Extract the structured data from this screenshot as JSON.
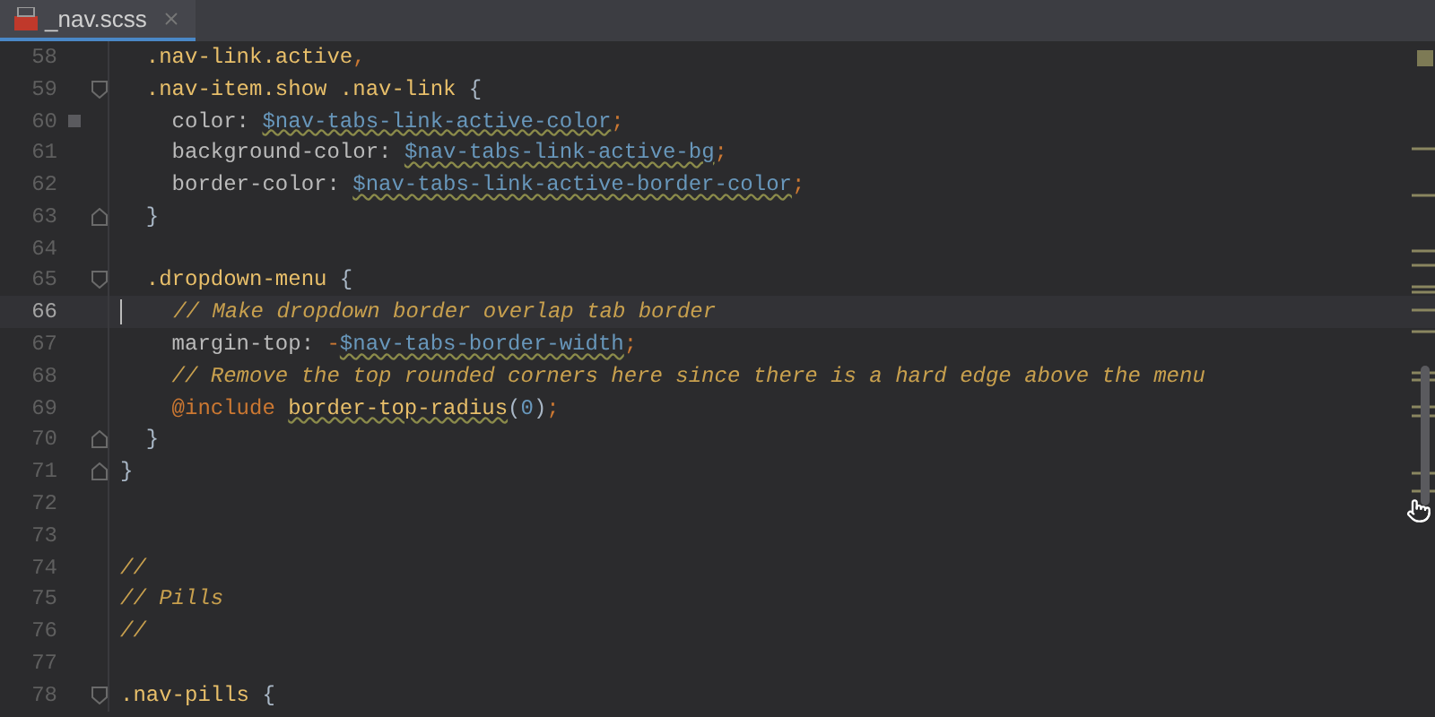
{
  "tabs": [
    {
      "label": "_nav.scss",
      "selected": true
    }
  ],
  "lines": [
    {
      "number": "58",
      "current": false,
      "fold_start": false,
      "fold_end": false,
      "segments": [
        {
          "kind": "selector",
          "text": "  .nav-link.active"
        },
        {
          "kind": "punct",
          "text": ","
        }
      ]
    },
    {
      "number": "59",
      "current": false,
      "fold_start": true,
      "fold_end": false,
      "segments": [
        {
          "kind": "selector",
          "text": "  .nav-item.show .nav-link"
        },
        {
          "kind": "plain",
          "text": " {"
        }
      ]
    },
    {
      "number": "60",
      "current": false,
      "fold_start": false,
      "fold_end": false,
      "bookmark": true,
      "segments": [
        {
          "kind": "property",
          "text": "    color: "
        },
        {
          "kind": "variable",
          "text": "$nav-tabs-link-active-color"
        },
        {
          "kind": "punct",
          "text": ";"
        }
      ]
    },
    {
      "number": "61",
      "current": false,
      "fold_start": false,
      "fold_end": false,
      "segments": [
        {
          "kind": "property",
          "text": "    background-color: "
        },
        {
          "kind": "variable",
          "text": "$nav-tabs-link-active-bg"
        },
        {
          "kind": "punct",
          "text": ";"
        }
      ]
    },
    {
      "number": "62",
      "current": false,
      "fold_start": false,
      "fold_end": false,
      "segments": [
        {
          "kind": "property",
          "text": "    border-color: "
        },
        {
          "kind": "variable",
          "text": "$nav-tabs-link-active-border-color"
        },
        {
          "kind": "punct",
          "text": ";"
        }
      ]
    },
    {
      "number": "63",
      "current": false,
      "fold_start": false,
      "fold_end": true,
      "segments": [
        {
          "kind": "plain",
          "text": "  }"
        }
      ]
    },
    {
      "number": "64",
      "current": false,
      "fold_start": false,
      "fold_end": false
    },
    {
      "number": "65",
      "current": false,
      "fold_start": true,
      "fold_end": false,
      "segments": [
        {
          "kind": "selector",
          "text": "  .dropdown-menu"
        },
        {
          "kind": "plain",
          "text": " {"
        }
      ]
    },
    {
      "number": "66",
      "current": true,
      "fold_start": false,
      "fold_end": false,
      "segments": [
        {
          "kind": "comment",
          "text": "   // Make dropdown border overlap tab border"
        }
      ]
    },
    {
      "number": "67",
      "current": false,
      "fold_start": false,
      "fold_end": false,
      "segments": [
        {
          "kind": "property",
          "text": "    margin-top: "
        },
        {
          "kind": "punct",
          "text": "-"
        },
        {
          "kind": "variable",
          "text": "$nav-tabs-border-width"
        },
        {
          "kind": "punct",
          "text": ";"
        }
      ]
    },
    {
      "number": "68",
      "current": false,
      "fold_start": false,
      "fold_end": false,
      "segments": [
        {
          "kind": "comment",
          "text": "    // Remove the top rounded corners here since there is a hard edge above the menu"
        }
      ]
    },
    {
      "number": "69",
      "current": false,
      "fold_start": false,
      "fold_end": false,
      "segments": [
        {
          "kind": "keyword",
          "text": "    @include "
        },
        {
          "kind": "function",
          "text": "border-top-radius"
        },
        {
          "kind": "plain",
          "text": "("
        },
        {
          "kind": "number",
          "text": "0"
        },
        {
          "kind": "plain",
          "text": ")"
        },
        {
          "kind": "punct",
          "text": ";"
        }
      ]
    },
    {
      "number": "70",
      "current": false,
      "fold_start": false,
      "fold_end": true,
      "segments": [
        {
          "kind": "plain",
          "text": "  }"
        }
      ]
    },
    {
      "number": "71",
      "current": false,
      "fold_start": false,
      "fold_end": true,
      "segments": [
        {
          "kind": "plain",
          "text": "}"
        }
      ]
    },
    {
      "number": "72",
      "current": false,
      "fold_start": false,
      "fold_end": false
    },
    {
      "number": "73",
      "current": false,
      "fold_start": false,
      "fold_end": false
    },
    {
      "number": "74",
      "current": false,
      "fold_start": false,
      "fold_end": false,
      "segments": [
        {
          "kind": "comment",
          "text": "//"
        }
      ]
    },
    {
      "number": "75",
      "current": false,
      "fold_start": false,
      "fold_end": false,
      "segments": [
        {
          "kind": "comment",
          "text": "// Pills"
        }
      ]
    },
    {
      "number": "76",
      "current": false,
      "fold_start": false,
      "fold_end": false,
      "segments": [
        {
          "kind": "comment",
          "text": "//"
        }
      ]
    },
    {
      "number": "77",
      "current": false,
      "fold_start": false,
      "fold_end": false
    },
    {
      "number": "78",
      "current": false,
      "fold_start": true,
      "fold_end": false,
      "segments": [
        {
          "kind": "selector",
          "text": ".nav-pills"
        },
        {
          "kind": "plain",
          "text": " {"
        }
      ]
    }
  ]
}
